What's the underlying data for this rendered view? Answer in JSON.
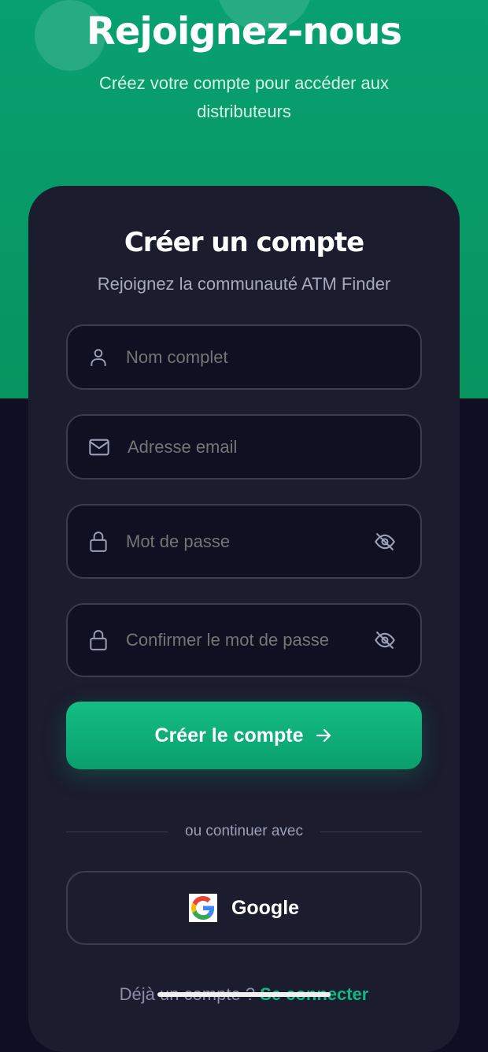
{
  "hero": {
    "title": "Rejoignez-nous",
    "subtitle": "Créez votre compte pour accéder aux distributeurs"
  },
  "card": {
    "title": "Créer un compte",
    "subtitle": "Rejoignez la communauté ATM Finder"
  },
  "fields": {
    "name": {
      "placeholder": "Nom complet",
      "icon": "user-icon"
    },
    "email": {
      "placeholder": "Adresse email",
      "icon": "mail-icon"
    },
    "password": {
      "placeholder": "Mot de passe",
      "icon": "lock-icon",
      "toggle_icon": "eye-off-icon"
    },
    "confirm": {
      "placeholder": "Confirmer le mot de passe",
      "icon": "lock-icon",
      "toggle_icon": "eye-off-icon"
    }
  },
  "submit": {
    "label": "Créer le compte",
    "icon": "arrow-right-icon"
  },
  "divider": "ou continuer avec",
  "google": {
    "label": "Google"
  },
  "footer": {
    "text": "Déjà un compte ?",
    "link": "Se connecter"
  },
  "colors": {
    "accent": "#10b981",
    "background": "#0f0f23",
    "card": "#1b1c2e"
  }
}
